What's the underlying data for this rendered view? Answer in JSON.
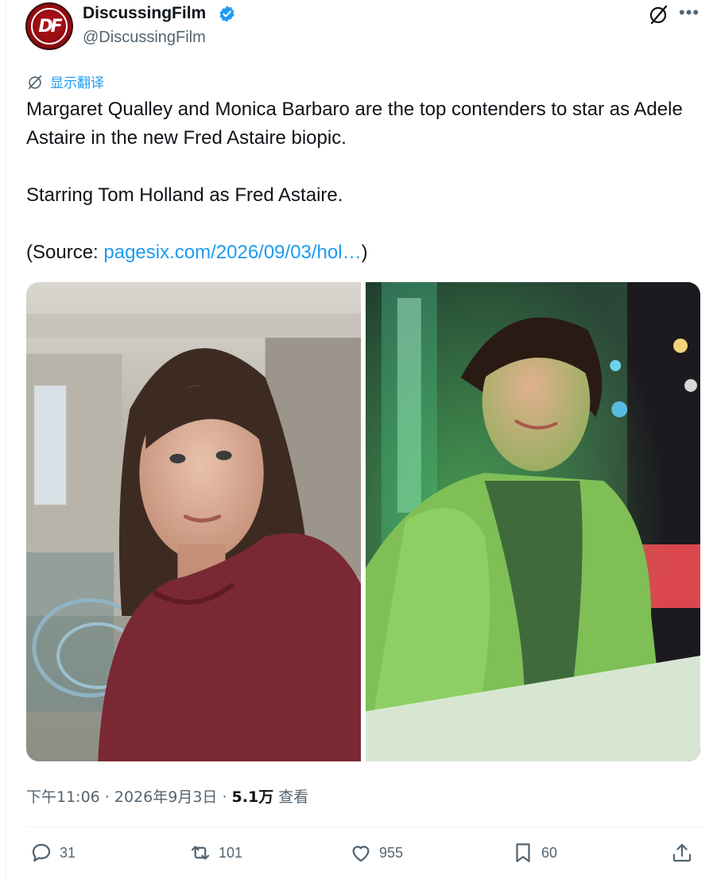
{
  "author": {
    "avatar_text": "DF",
    "display_name": "DiscussingFilm",
    "handle": "@DiscussingFilm",
    "verified": true
  },
  "header": {
    "grok_icon": "grok-icon",
    "more_icon": "more-icon"
  },
  "translate": {
    "label": "显示翻译"
  },
  "tweet": {
    "line1": "Margaret Qualley and Monica Barbaro are the top contenders to star as Adele Astaire in the new Fred Astaire biopic.",
    "line2": "Starring Tom Holland as Fred Astaire.",
    "source_prefix": "(Source: ",
    "source_link": "pagesix.com/2026/09/03/hol…",
    "source_suffix": ")"
  },
  "media": [
    {
      "label": "photo-margaret-qualley"
    },
    {
      "label": "photo-monica-barbaro"
    }
  ],
  "meta": {
    "time": "下午11:06",
    "sep1": " · ",
    "date": "2026年9月3日",
    "sep2": " · ",
    "views_count": "5.1万",
    "views_label": " 查看"
  },
  "actions": {
    "replies": "31",
    "reposts": "101",
    "likes": "955",
    "bookmarks": "60"
  },
  "colors": {
    "accent": "#1d9bf0",
    "secondary_text": "#536471",
    "primary_text": "#0f1419"
  }
}
